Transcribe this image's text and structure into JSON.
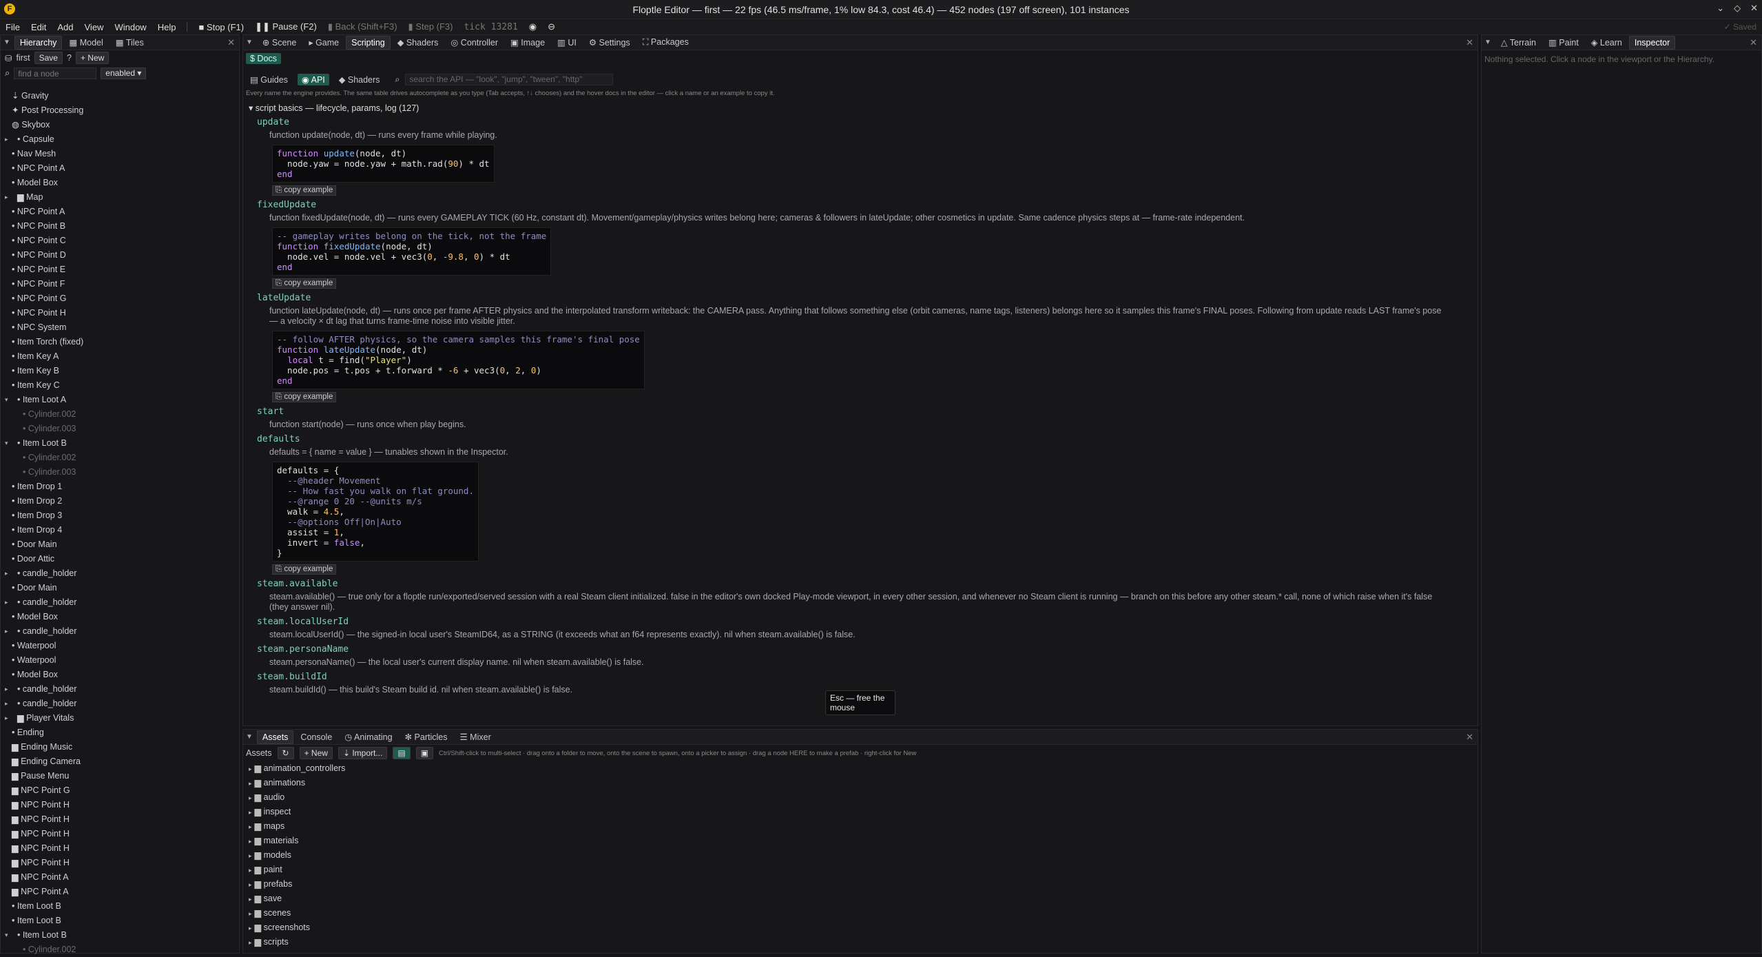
{
  "window": {
    "title": "Floptle Editor — first — 22 fps (46.5 ms/frame, 1% low 84.3, cost 46.4) — 452 nodes (197 off screen), 101 instances"
  },
  "menu": [
    "File",
    "Edit",
    "Add",
    "View",
    "Window",
    "Help"
  ],
  "toolbar": {
    "stop": "Stop (F1)",
    "pause": "Pause (F2)",
    "back": "Back (Shift+F3)",
    "step": "Step (F3)",
    "tick": "tick 13281",
    "saved": "✓ Saved"
  },
  "left": {
    "tabs": [
      "Hierarchy",
      "Model",
      "Tiles"
    ],
    "scene": "first",
    "save": "Save",
    "help": "?",
    "new": "New",
    "search_placeholder": "find a node",
    "filter": "enabled",
    "rows": [
      {
        "label": "Gravity",
        "indent": 0,
        "icon": "⇣",
        "tw": ""
      },
      {
        "label": "Post Processing",
        "indent": 0,
        "icon": "✦",
        "tw": ""
      },
      {
        "label": "Skybox",
        "indent": 0,
        "icon": "◍",
        "tw": ""
      },
      {
        "label": "Capsule",
        "indent": 1,
        "icon": "•",
        "tw": "▸"
      },
      {
        "label": "Nav Mesh",
        "indent": 0,
        "icon": "•",
        "tw": ""
      },
      {
        "label": "NPC Point A",
        "indent": 0,
        "icon": "•",
        "tw": ""
      },
      {
        "label": "Model Box",
        "indent": 0,
        "icon": "•",
        "tw": ""
      },
      {
        "label": "Map",
        "indent": 1,
        "icon": "▆",
        "tw": "▸"
      },
      {
        "label": "NPC Point A",
        "indent": 0,
        "icon": "•",
        "tw": ""
      },
      {
        "label": "NPC Point B",
        "indent": 0,
        "icon": "•",
        "tw": ""
      },
      {
        "label": "NPC Point C",
        "indent": 0,
        "icon": "•",
        "tw": ""
      },
      {
        "label": "NPC Point D",
        "indent": 0,
        "icon": "•",
        "tw": ""
      },
      {
        "label": "NPC Point E",
        "indent": 0,
        "icon": "•",
        "tw": ""
      },
      {
        "label": "NPC Point F",
        "indent": 0,
        "icon": "•",
        "tw": ""
      },
      {
        "label": "NPC Point G",
        "indent": 0,
        "icon": "•",
        "tw": ""
      },
      {
        "label": "NPC Point H",
        "indent": 0,
        "icon": "•",
        "tw": ""
      },
      {
        "label": "NPC System",
        "indent": 0,
        "icon": "•",
        "tw": ""
      },
      {
        "label": "Item Torch (fixed)",
        "indent": 0,
        "icon": "•",
        "tw": ""
      },
      {
        "label": "Item Key A",
        "indent": 0,
        "icon": "•",
        "tw": ""
      },
      {
        "label": "Item Key B",
        "indent": 0,
        "icon": "•",
        "tw": ""
      },
      {
        "label": "Item Key C",
        "indent": 0,
        "icon": "•",
        "tw": ""
      },
      {
        "label": "Item Loot A",
        "indent": 1,
        "icon": "•",
        "tw": "▾"
      },
      {
        "label": "Cylinder.002",
        "indent": 2,
        "icon": "•",
        "tw": "",
        "dim": true
      },
      {
        "label": "Cylinder.003",
        "indent": 2,
        "icon": "•",
        "tw": "",
        "dim": true
      },
      {
        "label": "Item Loot B",
        "indent": 1,
        "icon": "•",
        "tw": "▾"
      },
      {
        "label": "Cylinder.002",
        "indent": 2,
        "icon": "•",
        "tw": "",
        "dim": true
      },
      {
        "label": "Cylinder.003",
        "indent": 2,
        "icon": "•",
        "tw": "",
        "dim": true
      },
      {
        "label": "Item Drop 1",
        "indent": 0,
        "icon": "•",
        "tw": ""
      },
      {
        "label": "Item Drop 2",
        "indent": 0,
        "icon": "•",
        "tw": ""
      },
      {
        "label": "Item Drop 3",
        "indent": 0,
        "icon": "•",
        "tw": ""
      },
      {
        "label": "Item Drop 4",
        "indent": 0,
        "icon": "•",
        "tw": ""
      },
      {
        "label": "Door Main",
        "indent": 0,
        "icon": "•",
        "tw": ""
      },
      {
        "label": "Door Attic",
        "indent": 0,
        "icon": "•",
        "tw": ""
      },
      {
        "label": "candle_holder",
        "indent": 1,
        "icon": "•",
        "tw": "▸"
      },
      {
        "label": "Door Main",
        "indent": 0,
        "icon": "•",
        "tw": ""
      },
      {
        "label": "candle_holder",
        "indent": 1,
        "icon": "•",
        "tw": "▸"
      },
      {
        "label": "Model Box",
        "indent": 0,
        "icon": "•",
        "tw": ""
      },
      {
        "label": "candle_holder",
        "indent": 1,
        "icon": "•",
        "tw": "▸"
      },
      {
        "label": "Waterpool",
        "indent": 0,
        "icon": "•",
        "tw": ""
      },
      {
        "label": "Waterpool",
        "indent": 0,
        "icon": "•",
        "tw": ""
      },
      {
        "label": "Model Box",
        "indent": 0,
        "icon": "•",
        "tw": ""
      },
      {
        "label": "candle_holder",
        "indent": 1,
        "icon": "•",
        "tw": "▸"
      },
      {
        "label": "candle_holder",
        "indent": 1,
        "icon": "•",
        "tw": "▸"
      },
      {
        "label": "Player Vitals",
        "indent": 1,
        "icon": "▆",
        "tw": "▸"
      },
      {
        "label": "Ending",
        "indent": 0,
        "icon": "•",
        "tw": ""
      },
      {
        "label": "Ending Music",
        "indent": 0,
        "icon": "▆",
        "tw": ""
      },
      {
        "label": "Ending Camera",
        "indent": 0,
        "icon": "▆",
        "tw": ""
      },
      {
        "label": "Pause Menu",
        "indent": 0,
        "icon": "▆",
        "tw": ""
      },
      {
        "label": "NPC Point G",
        "indent": 0,
        "icon": "▆",
        "tw": ""
      },
      {
        "label": "NPC Point H",
        "indent": 0,
        "icon": "▆",
        "tw": ""
      },
      {
        "label": "NPC Point H",
        "indent": 0,
        "icon": "▆",
        "tw": ""
      },
      {
        "label": "NPC Point H",
        "indent": 0,
        "icon": "▆",
        "tw": ""
      },
      {
        "label": "NPC Point H",
        "indent": 0,
        "icon": "▆",
        "tw": ""
      },
      {
        "label": "NPC Point H",
        "indent": 0,
        "icon": "▆",
        "tw": ""
      },
      {
        "label": "NPC Point A",
        "indent": 0,
        "icon": "▆",
        "tw": ""
      },
      {
        "label": "NPC Point A",
        "indent": 0,
        "icon": "▆",
        "tw": ""
      },
      {
        "label": "Item Loot B",
        "indent": 0,
        "icon": "•",
        "tw": ""
      },
      {
        "label": "Item Loot B",
        "indent": 0,
        "icon": "•",
        "tw": ""
      },
      {
        "label": "Item Loot B",
        "indent": 1,
        "icon": "•",
        "tw": "▾"
      },
      {
        "label": "Cylinder.002",
        "indent": 2,
        "icon": "•",
        "tw": "",
        "dim": true
      }
    ]
  },
  "center": {
    "tabs": [
      "Scene",
      "Game",
      "Scripting",
      "Shaders",
      "Controller",
      "Image",
      "UI",
      "Settings",
      "Packages"
    ],
    "active_tab": "Scripting",
    "docs": "$ Docs",
    "subtabs": [
      "Guides",
      "API",
      "Shaders"
    ],
    "search_placeholder": "search the API — \"look\", \"jump\", \"tween\", \"http\"",
    "hint": "Every name the engine provides. The same table drives autocomplete as you type (Tab accepts, ↑↓ chooses) and the hover docs in the editor — click a name or an example to copy it.",
    "section": "script basics — lifecycle, params, log  (127)",
    "copy_label": "copy example",
    "entries": [
      {
        "name": "update",
        "desc": "function update(node, dt) — runs every frame while playing."
      },
      {
        "name": "fixedUpdate",
        "desc": "function fixedUpdate(node, dt) — runs every GAMEPLAY TICK (60 Hz, constant dt). Movement/gameplay/physics writes belong here; cameras & followers in lateUpdate; other cosmetics in update. Same cadence physics steps at — frame-rate independent."
      },
      {
        "name": "lateUpdate",
        "desc": "function lateUpdate(node, dt) — runs once per frame AFTER physics and the interpolated transform writeback: the CAMERA pass. Anything that follows something else (orbit cameras, name tags, listeners) belongs here so it samples this frame's FINAL poses. Following from update reads LAST frame's pose — a velocity × dt lag that turns frame-time noise into visible jitter."
      },
      {
        "name": "start",
        "desc": "function start(node) — runs once when play begins."
      },
      {
        "name": "defaults",
        "desc": "defaults = { name = value } — tunables shown in the Inspector."
      },
      {
        "name": "steam.available",
        "desc": "steam.available() — true only for a floptle run/exported/served session with a real Steam client initialized. false in the editor's own docked Play-mode viewport, in every other session, and whenever no Steam client is running — branch on this before any other steam.* call, none of which raise when it's false (they answer nil)."
      },
      {
        "name": "steam.localUserId",
        "desc": "steam.localUserId() — the signed-in local user's SteamID64, as a STRING (it exceeds what an f64 represents exactly). nil when steam.available() is false."
      },
      {
        "name": "steam.personaName",
        "desc": "steam.personaName() — the local user's current display name. nil when steam.available() is false."
      },
      {
        "name": "steam.buildId",
        "desc": "steam.buildId() — this build's Steam build id. nil when steam.available() is false."
      }
    ],
    "tooltip": "Esc — free the mouse"
  },
  "right": {
    "tabs": [
      "Terrain",
      "Paint",
      "Learn",
      "Inspector"
    ],
    "active_tab": "Inspector",
    "message": "Nothing selected. Click a node in the viewport or the Hierarchy."
  },
  "bottom": {
    "tabs": [
      "Assets",
      "Console",
      "Animating",
      "Particles",
      "Mixer"
    ],
    "active_tab": "Assets",
    "label": "Assets",
    "new": "New",
    "import": "Import...",
    "hint": "Ctrl/Shift-click to multi-select · drag onto a folder to move, onto the scene to spawn, onto a picker to assign · drag a node HERE to make a prefab · right-click for New",
    "folders": [
      "animation_controllers",
      "animations",
      "audio",
      "inspect",
      "maps",
      "materials",
      "models",
      "paint",
      "prefabs",
      "save",
      "scenes",
      "screenshots",
      "scripts"
    ]
  }
}
